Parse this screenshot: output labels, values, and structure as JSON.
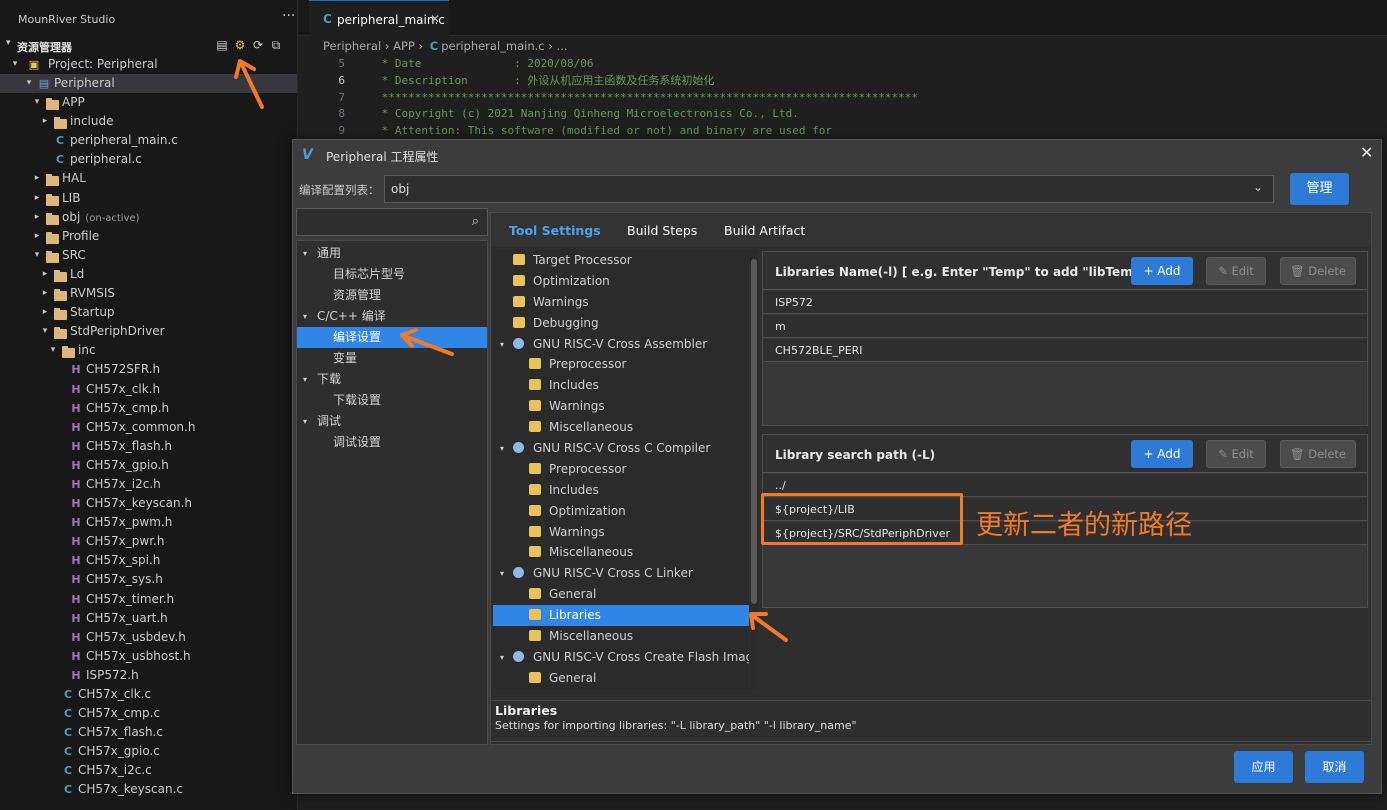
{
  "app": {
    "name": "MounRiver Studio",
    "explorer_label": "资源管理器",
    "project_label": "Project: Peripheral"
  },
  "tree": [
    {
      "depth": 1,
      "chev": "▾",
      "icon": "project",
      "label": "Peripheral",
      "sel": true
    },
    {
      "depth": 2,
      "chev": "▾",
      "icon": "folder",
      "label": "APP"
    },
    {
      "depth": 3,
      "chev": "▸",
      "icon": "folder",
      "label": "include"
    },
    {
      "depth": 3,
      "chev": "",
      "icon": "C",
      "label": "peripheral_main.c"
    },
    {
      "depth": 3,
      "chev": "",
      "icon": "C",
      "label": "peripheral.c"
    },
    {
      "depth": 2,
      "chev": "▸",
      "icon": "folder",
      "label": "HAL"
    },
    {
      "depth": 2,
      "chev": "▸",
      "icon": "folder",
      "label": "LIB"
    },
    {
      "depth": 2,
      "chev": "▸",
      "icon": "folder",
      "label": "obj",
      "note": "(on-active)"
    },
    {
      "depth": 2,
      "chev": "▸",
      "icon": "folder",
      "label": "Profile"
    },
    {
      "depth": 2,
      "chev": "▾",
      "icon": "folder",
      "label": "SRC"
    },
    {
      "depth": 3,
      "chev": "▸",
      "icon": "folder",
      "label": "Ld"
    },
    {
      "depth": 3,
      "chev": "▸",
      "icon": "folder",
      "label": "RVMSIS"
    },
    {
      "depth": 3,
      "chev": "▸",
      "icon": "folder",
      "label": "Startup"
    },
    {
      "depth": 3,
      "chev": "▾",
      "icon": "folder",
      "label": "StdPeriphDriver"
    },
    {
      "depth": 4,
      "chev": "▾",
      "icon": "folder",
      "label": "inc"
    },
    {
      "depth": 5,
      "chev": "",
      "icon": "H",
      "label": "CH572SFR.h"
    },
    {
      "depth": 5,
      "chev": "",
      "icon": "H",
      "label": "CH57x_clk.h"
    },
    {
      "depth": 5,
      "chev": "",
      "icon": "H",
      "label": "CH57x_cmp.h"
    },
    {
      "depth": 5,
      "chev": "",
      "icon": "H",
      "label": "CH57x_common.h"
    },
    {
      "depth": 5,
      "chev": "",
      "icon": "H",
      "label": "CH57x_flash.h"
    },
    {
      "depth": 5,
      "chev": "",
      "icon": "H",
      "label": "CH57x_gpio.h"
    },
    {
      "depth": 5,
      "chev": "",
      "icon": "H",
      "label": "CH57x_i2c.h"
    },
    {
      "depth": 5,
      "chev": "",
      "icon": "H",
      "label": "CH57x_keyscan.h"
    },
    {
      "depth": 5,
      "chev": "",
      "icon": "H",
      "label": "CH57x_pwm.h"
    },
    {
      "depth": 5,
      "chev": "",
      "icon": "H",
      "label": "CH57x_pwr.h"
    },
    {
      "depth": 5,
      "chev": "",
      "icon": "H",
      "label": "CH57x_spi.h"
    },
    {
      "depth": 5,
      "chev": "",
      "icon": "H",
      "label": "CH57x_sys.h"
    },
    {
      "depth": 5,
      "chev": "",
      "icon": "H",
      "label": "CH57x_timer.h"
    },
    {
      "depth": 5,
      "chev": "",
      "icon": "H",
      "label": "CH57x_uart.h"
    },
    {
      "depth": 5,
      "chev": "",
      "icon": "H",
      "label": "CH57x_usbdev.h"
    },
    {
      "depth": 5,
      "chev": "",
      "icon": "H",
      "label": "CH57x_usbhost.h"
    },
    {
      "depth": 5,
      "chev": "",
      "icon": "H",
      "label": "ISP572.h"
    },
    {
      "depth": 4,
      "chev": "",
      "icon": "C",
      "label": "CH57x_clk.c"
    },
    {
      "depth": 4,
      "chev": "",
      "icon": "C",
      "label": "CH57x_cmp.c"
    },
    {
      "depth": 4,
      "chev": "",
      "icon": "C",
      "label": "CH57x_flash.c"
    },
    {
      "depth": 4,
      "chev": "",
      "icon": "C",
      "label": "CH57x_gpio.c"
    },
    {
      "depth": 4,
      "chev": "",
      "icon": "C",
      "label": "CH57x_i2c.c"
    },
    {
      "depth": 4,
      "chev": "",
      "icon": "C",
      "label": "CH57x_keyscan.c"
    }
  ],
  "editor": {
    "tab_label": "peripheral_main.c",
    "breadcrumb": {
      "a": "Peripheral",
      "b": "APP",
      "file": "peripheral_main.c",
      "tail": "..."
    },
    "lines": [
      {
        "n": "5",
        "text": " * Date              : 2020/08/06"
      },
      {
        "n": "6",
        "text": " * Description       : 外设从机应用主函数及任务系统初始化",
        "cur": true
      },
      {
        "n": "7",
        "text": " *********************************************************************************"
      },
      {
        "n": "8",
        "text": " * Copyright (c) 2021 Nanjing Qinheng Microelectronics Co., Ltd."
      },
      {
        "n": "9",
        "text": " * Attention: This software (modified or not) and binary are used for"
      }
    ]
  },
  "dialog": {
    "title": "Peripheral 工程属性",
    "config_label": "编译配置列表：",
    "config_value": "obj",
    "manage_label": "管理",
    "nav": [
      {
        "label": "通用",
        "depth": 0,
        "chev": "▾"
      },
      {
        "label": "目标芯片型号",
        "depth": 1
      },
      {
        "label": "资源管理",
        "depth": 1
      },
      {
        "label": "C/C++ 编译",
        "depth": 0,
        "chev": "▾"
      },
      {
        "label": "编译设置",
        "depth": 1,
        "sel": true
      },
      {
        "label": "变量",
        "depth": 1
      },
      {
        "label": "下载",
        "depth": 0,
        "chev": "▾"
      },
      {
        "label": "下载设置",
        "depth": 1
      },
      {
        "label": "调试",
        "depth": 0,
        "chev": "▾"
      },
      {
        "label": "调试设置",
        "depth": 1
      }
    ],
    "tabs": [
      "Tool Settings",
      "Build Steps",
      "Build Artifact"
    ],
    "options": [
      {
        "label": "Target Processor",
        "depth": 1
      },
      {
        "label": "Optimization",
        "depth": 1
      },
      {
        "label": "Warnings",
        "depth": 1
      },
      {
        "label": "Debugging",
        "depth": 1
      },
      {
        "label": "GNU RISC-V Cross Assembler",
        "depth": 0,
        "chev": "▾",
        "gear": true
      },
      {
        "label": "Preprocessor",
        "depth": 2
      },
      {
        "label": "Includes",
        "depth": 2
      },
      {
        "label": "Warnings",
        "depth": 2
      },
      {
        "label": "Miscellaneous",
        "depth": 2
      },
      {
        "label": "GNU RISC-V Cross C Compiler",
        "depth": 0,
        "chev": "▾",
        "gear": true
      },
      {
        "label": "Preprocessor",
        "depth": 2
      },
      {
        "label": "Includes",
        "depth": 2
      },
      {
        "label": "Optimization",
        "depth": 2
      },
      {
        "label": "Warnings",
        "depth": 2
      },
      {
        "label": "Miscellaneous",
        "depth": 2
      },
      {
        "label": "GNU RISC-V Cross C Linker",
        "depth": 0,
        "chev": "▾",
        "gear": true
      },
      {
        "label": "General",
        "depth": 2
      },
      {
        "label": "Libraries",
        "depth": 2,
        "sel": true
      },
      {
        "label": "Miscellaneous",
        "depth": 2
      },
      {
        "label": "GNU RISC-V Cross Create Flash Image",
        "depth": 0,
        "chev": "▾",
        "gear": true
      },
      {
        "label": "General",
        "depth": 2
      }
    ],
    "libs_panel": {
      "header": "Libraries Name(-l) [ e.g. Enter \"Temp\" to add \"libTemp.a\" ]",
      "add": "+ Add",
      "edit": "✎ Edit",
      "del": "🗑 Delete",
      "items": [
        "ISP572",
        "m",
        "CH572BLE_PERI"
      ]
    },
    "search_panel": {
      "header": "Library search path (-L)",
      "add": "+ Add",
      "edit": "✎ Edit",
      "del": "🗑 Delete",
      "items": [
        "../",
        "${project}/LIB",
        "${project}/SRC/StdPeriphDriver"
      ]
    },
    "desc_title": "Libraries",
    "desc_text": "Settings for importing libraries: \"-L library_path\" \"-l library_name\"",
    "apply_label": "应用",
    "cancel_label": "取消"
  },
  "annotation": {
    "text": "更新二者的新路径",
    "color": "#f07a2a"
  }
}
